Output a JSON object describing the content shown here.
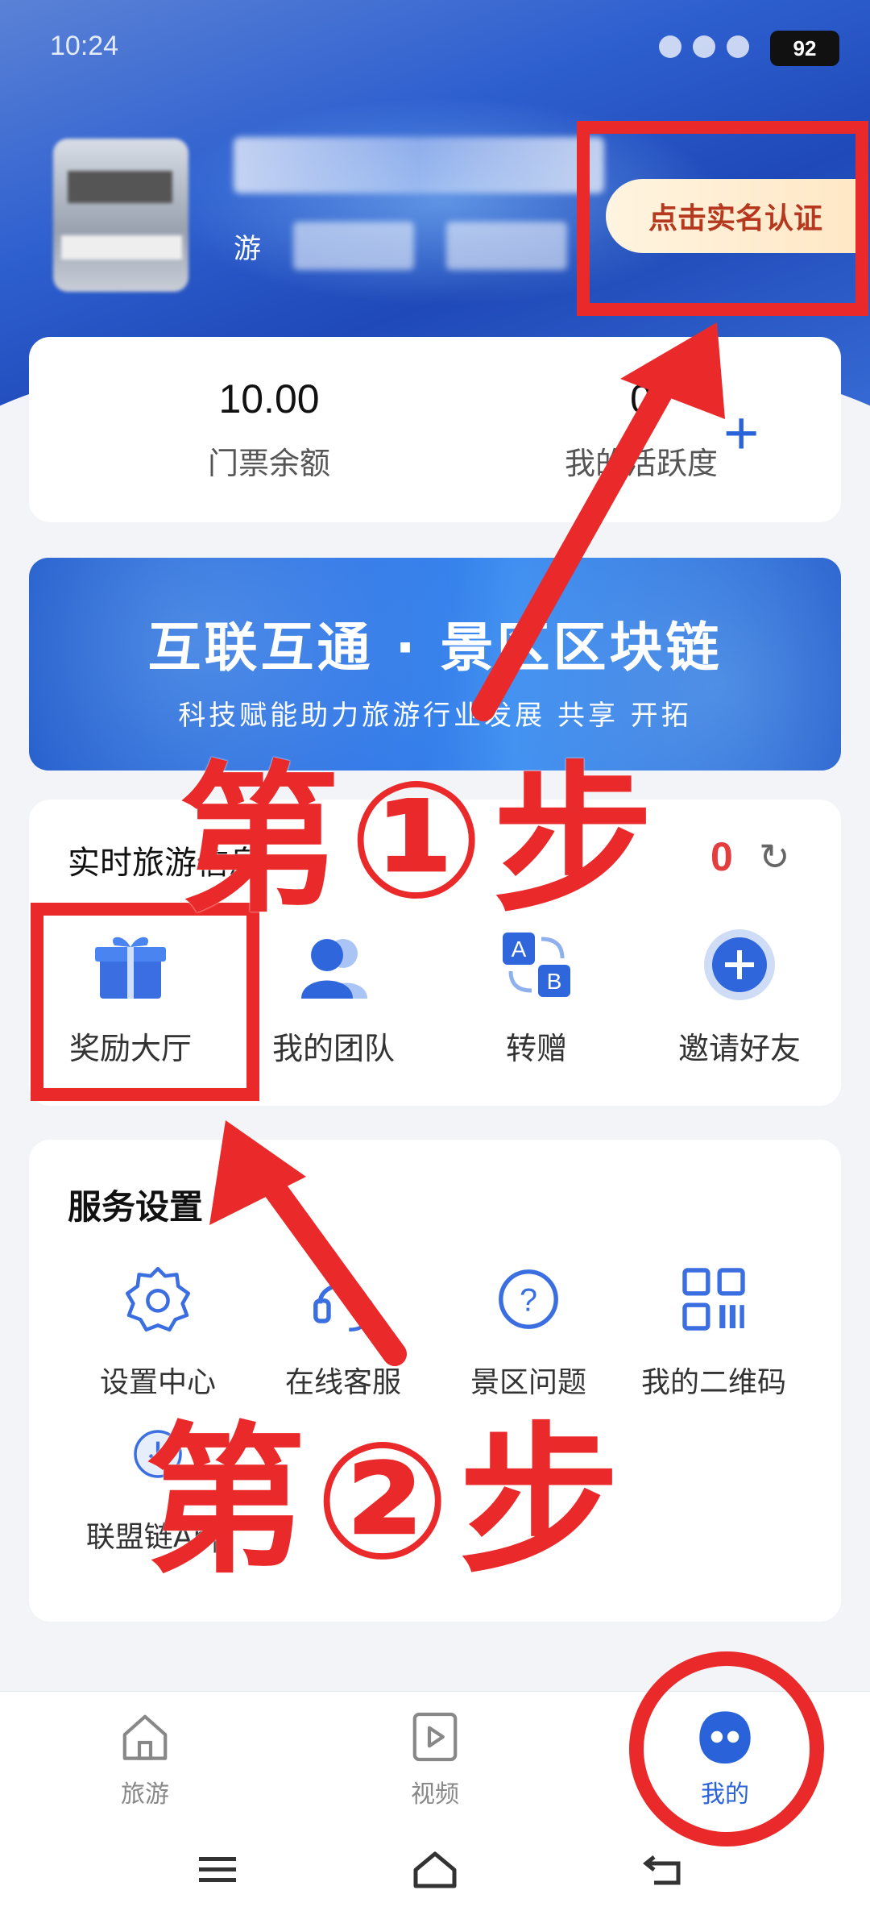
{
  "status_bar": {
    "time": "10:24",
    "battery": "92"
  },
  "profile": {
    "sub_label": "游",
    "verify_label": "点击实名认证"
  },
  "stats": [
    {
      "value": "10.00",
      "label": "门票余额"
    },
    {
      "value": "0",
      "label": "我的活跃度"
    }
  ],
  "banner": {
    "title": "互联互通 · 景区区块链",
    "subtitle": "科技赋能助力旅游行业发展 共享 开拓"
  },
  "realtime": {
    "title": "实时旅游信息",
    "count": "0",
    "items": [
      {
        "label": "奖励大厅",
        "icon": "gift-icon"
      },
      {
        "label": "我的团队",
        "icon": "team-icon"
      },
      {
        "label": "转赠",
        "icon": "transfer-icon"
      },
      {
        "label": "邀请好友",
        "icon": "invite-icon"
      }
    ]
  },
  "services": {
    "title": "服务设置",
    "items": [
      {
        "label": "设置中心",
        "icon": "gear-icon"
      },
      {
        "label": "在线客服",
        "icon": "headset-icon"
      },
      {
        "label": "景区问题",
        "icon": "question-icon"
      },
      {
        "label": "我的二维码",
        "icon": "qrcode-icon"
      },
      {
        "label": "联盟链App",
        "icon": "download-icon"
      }
    ]
  },
  "bottom_nav": [
    {
      "label": "旅游",
      "icon": "home-icon"
    },
    {
      "label": "视频",
      "icon": "video-icon"
    },
    {
      "label": "我的",
      "icon": "profile-face-icon"
    }
  ],
  "annotations": {
    "step1": "第①步",
    "step2": "第②步"
  },
  "colors": {
    "accent": "#2a62d9",
    "annotation_red": "#ea2a2a",
    "verify_text": "#b5381f"
  }
}
